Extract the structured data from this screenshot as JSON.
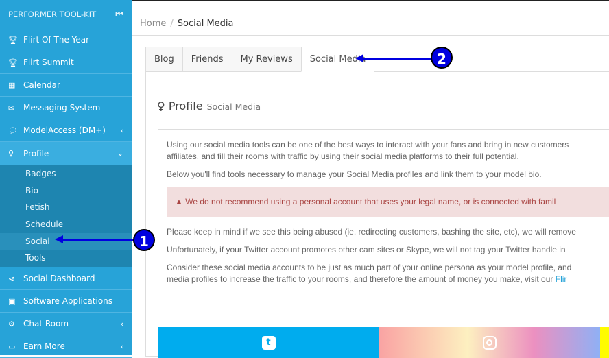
{
  "sidebar": {
    "title": "PERFORMER TOOL-KIT",
    "collapse_icon": "collapse-left-icon",
    "items": [
      {
        "label": "Flirt Of The Year",
        "icon": "trophy-icon"
      },
      {
        "label": "Flirt Summit",
        "icon": "trophy-icon"
      },
      {
        "label": "Calendar",
        "icon": "calendar-icon"
      },
      {
        "label": "Messaging System",
        "icon": "envelope-icon"
      },
      {
        "label": "ModelAccess (DM+)",
        "icon": "comments-icon"
      },
      {
        "label": "Profile",
        "icon": "female-icon"
      }
    ],
    "profile_sub": [
      "Badges",
      "Bio",
      "Fetish",
      "Schedule",
      "Social",
      "Tools"
    ],
    "items2": [
      {
        "label": "Social Dashboard",
        "icon": "share-icon"
      },
      {
        "label": "Software Applications",
        "icon": "floppy-icon"
      },
      {
        "label": "Chat Room",
        "icon": "cogs-icon"
      },
      {
        "label": "Earn More",
        "icon": "money-icon"
      }
    ]
  },
  "breadcrumb": {
    "home": "Home",
    "current": "Social Media"
  },
  "tabs": [
    "Blog",
    "Friends",
    "My Reviews",
    "Social Media"
  ],
  "profile": {
    "title": "Profile",
    "subtitle": "Social Media"
  },
  "info": {
    "p1a": "Using our social media tools can be one of the best ways to interact with your fans and bring in new customers",
    "p1b": "affiliates, and fill their rooms with traffic by using their social media platforms to their full potential.",
    "p2": "Below you'll find tools necessary to manage your Social Media profiles and link them to your model bio.",
    "alert": "We do not recommend using a personal account that uses your legal name, or is connected with famil",
    "p3": "Please keep in mind if we see this being abused (ie. redirecting customers, bashing the site, etc), we will remove",
    "p4": "Unfortunately, if your Twitter account promotes other cam sites or Skype, we will not tag your Twitter handle in",
    "p5a": "Consider these social media accounts to be just as much part of your online persona as your model profile, and",
    "p5b": "media profiles to increase the traffic to your rooms, and therefore the amount of money you make, visit our ",
    "link": "Flir"
  },
  "social": [
    "twitter-icon",
    "instagram-icon",
    "snapchat-icon"
  ],
  "annotations": [
    "1",
    "2"
  ],
  "colors": {
    "sidebar": "#27a3d8",
    "submenu": "#1e85b0",
    "twitter": "#00acee",
    "alert_bg": "#f2dede",
    "annotation": "#0000e0"
  }
}
